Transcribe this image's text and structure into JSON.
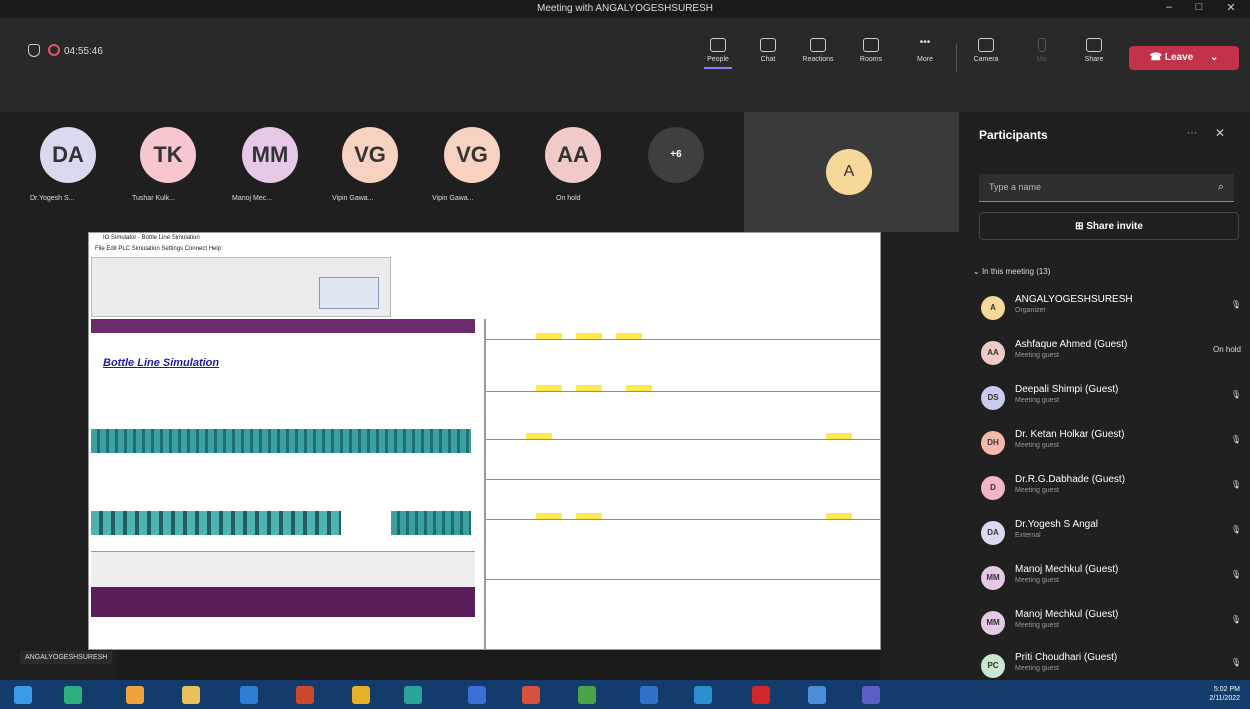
{
  "window": {
    "title": "Meeting with ANGALYOGESHSURESH"
  },
  "toolbar": {
    "timer": "04:55:46",
    "items": [
      {
        "label": "People"
      },
      {
        "label": "Chat"
      },
      {
        "label": "Reactions"
      },
      {
        "label": "Rooms"
      },
      {
        "label": "More"
      },
      {
        "label": "Camera"
      },
      {
        "label": "Mic"
      },
      {
        "label": "Share"
      }
    ],
    "leave_label": "Leave"
  },
  "gallery": [
    {
      "initials": "DA",
      "name": "Dr.Yogesh S...",
      "color": "#d9d9ef"
    },
    {
      "initials": "TK",
      "name": "Tushar Kulk...",
      "color": "#f7c6cf"
    },
    {
      "initials": "MM",
      "name": "Manoj Mec...",
      "color": "#e6c9e6"
    },
    {
      "initials": "VG",
      "name": "Vipin Gawa...",
      "color": "#f8d2c1"
    },
    {
      "initials": "VG",
      "name": "Vipin Gawa...",
      "color": "#f8d2c1"
    },
    {
      "initials": "AA",
      "name": "On hold",
      "color": "#f0c9c9"
    },
    {
      "initials": "+6",
      "name": "",
      "color": "#3f3f3f"
    }
  ],
  "spotlight": {
    "initials": "A"
  },
  "shared_screen": {
    "app_title": "IO Simulator - Bottle Line Simulation",
    "menu": "File  Edit  PLC  Simulation  Settings  Connect  Help",
    "sim_title": "Bottle Line Simulation"
  },
  "self_label": "ANGALYOGESHSURESH",
  "participants": {
    "title": "Participants",
    "search_placeholder": "Type a name",
    "share_invite": "Share invite",
    "section_label": "In this meeting (13)",
    "list": [
      {
        "initials": "A",
        "name": "ANGALYOGESHSURESH",
        "role": "Organizer",
        "color": "#f6d89a",
        "right": ""
      },
      {
        "initials": "AA",
        "name": "Ashfaque Ahmed (Guest)",
        "role": "Meeting guest",
        "color": "#f0c9c9",
        "right": "On hold"
      },
      {
        "initials": "DS",
        "name": "Deepali Shimpi (Guest)",
        "role": "Meeting guest",
        "color": "#c9cbef",
        "right": ""
      },
      {
        "initials": "DH",
        "name": "Dr. Ketan Holkar (Guest)",
        "role": "Meeting guest",
        "color": "#f4b9a8",
        "right": ""
      },
      {
        "initials": "D",
        "name": "Dr.R.G.Dabhade (Guest)",
        "role": "Meeting guest",
        "color": "#f3b6c6",
        "right": ""
      },
      {
        "initials": "DA",
        "name": "Dr.Yogesh S Angal",
        "role": "External",
        "color": "#d9d9ef",
        "right": ""
      },
      {
        "initials": "MM",
        "name": "Manoj Mechkul (Guest)",
        "role": "Meeting guest",
        "color": "#e6c9e6",
        "right": ""
      },
      {
        "initials": "MM",
        "name": "Manoj Mechkul (Guest)",
        "role": "Meeting guest",
        "color": "#e6c9e6",
        "right": ""
      },
      {
        "initials": "PC",
        "name": "Priti Choudhari (Guest)",
        "role": "Meeting guest",
        "color": "#c9e6cf",
        "right": ""
      }
    ]
  },
  "taskbar": {
    "time": "5:02 PM",
    "date": "2/11/2022"
  },
  "colors": {
    "accent": "#7f85f5",
    "leave": "#c4314b",
    "taskbar": "#133c6d"
  }
}
